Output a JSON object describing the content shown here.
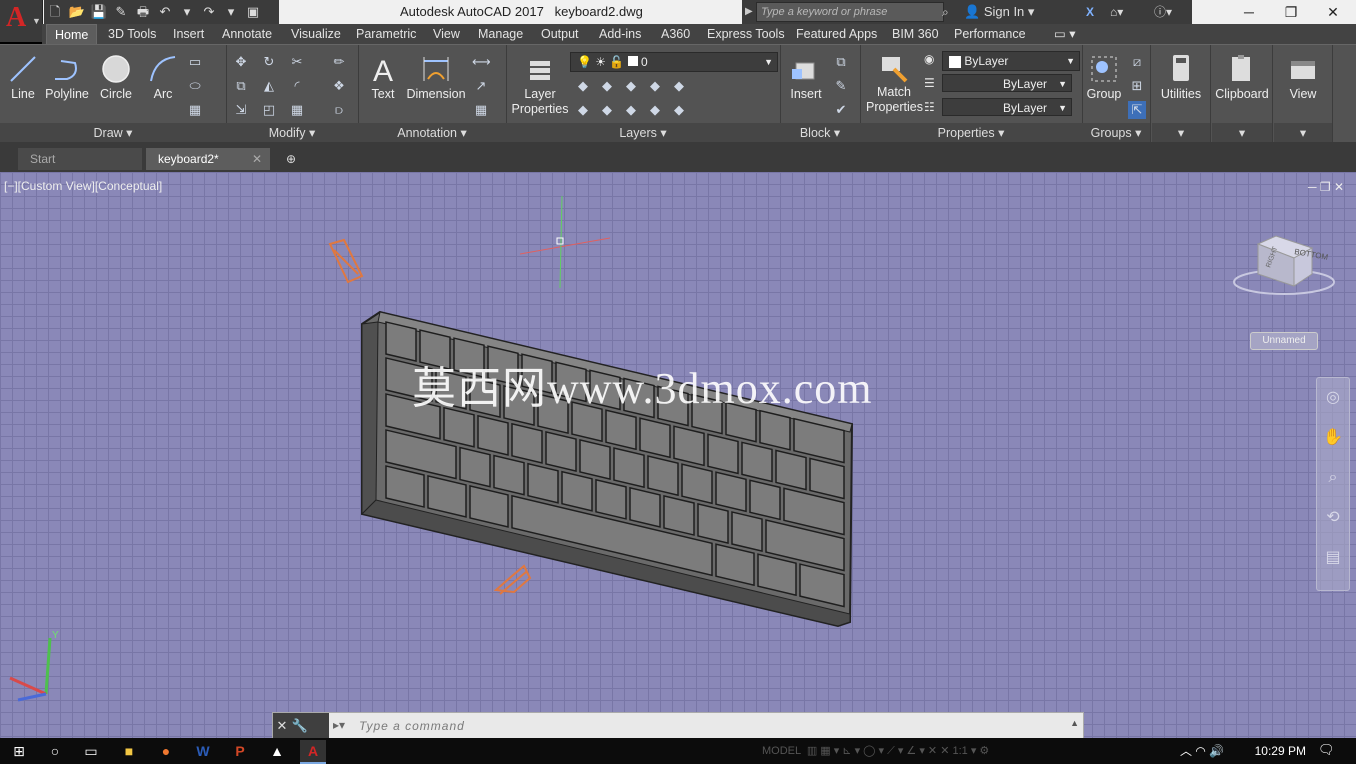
{
  "app": {
    "logo_letter": "A",
    "window_title": "Autodesk AutoCAD 2017",
    "file_name": "keyboard2.dwg",
    "search_placeholder": "Type a keyword or phrase",
    "sign_in": "Sign In"
  },
  "ribbon_tabs": [
    "Home",
    "3D Tools",
    "Insert",
    "Annotate",
    "Visualize",
    "Parametric",
    "View",
    "Manage",
    "Output",
    "Add-ins",
    "A360",
    "Express Tools",
    "Featured Apps",
    "BIM 360",
    "Performance"
  ],
  "active_tab": "Home",
  "panels": {
    "draw": {
      "title": "Draw",
      "tools": [
        "Line",
        "Polyline",
        "Circle",
        "Arc"
      ]
    },
    "modify": {
      "title": "Modify"
    },
    "annotation": {
      "title": "Annotation",
      "tools": [
        "Text",
        "Dimension"
      ]
    },
    "layers": {
      "title": "Layers",
      "layer_properties": "Layer Properties",
      "current_layer": "0"
    },
    "block": {
      "title": "Block",
      "insert": "Insert"
    },
    "properties": {
      "title": "Properties",
      "match_properties": "Match Properties",
      "color": "ByLayer",
      "linetype": "ByLayer",
      "lineweight": "ByLayer"
    },
    "groups": {
      "title": "Groups",
      "group": "Group"
    },
    "utilities": {
      "label": "Utilities"
    },
    "clipboard": {
      "label": "Clipboard"
    },
    "view": {
      "label": "View"
    }
  },
  "file_tabs": [
    {
      "label": "Start",
      "active": false
    },
    {
      "label": "keyboard2*",
      "active": true
    }
  ],
  "viewport": {
    "label": "[−][Custom View][Conceptual]",
    "viewcube_face": "BOTTOM",
    "viewcube_side": "RIGHT",
    "ucs_name": "Unnamed",
    "watermark": "莫西网www.3dmox.com",
    "background_color": "#8a88b8"
  },
  "command_line": {
    "placeholder": "Type a command"
  },
  "status_bar": {
    "model": "MODEL",
    "scale": "1:1"
  },
  "taskbar": {
    "clock": "10:29 PM"
  }
}
